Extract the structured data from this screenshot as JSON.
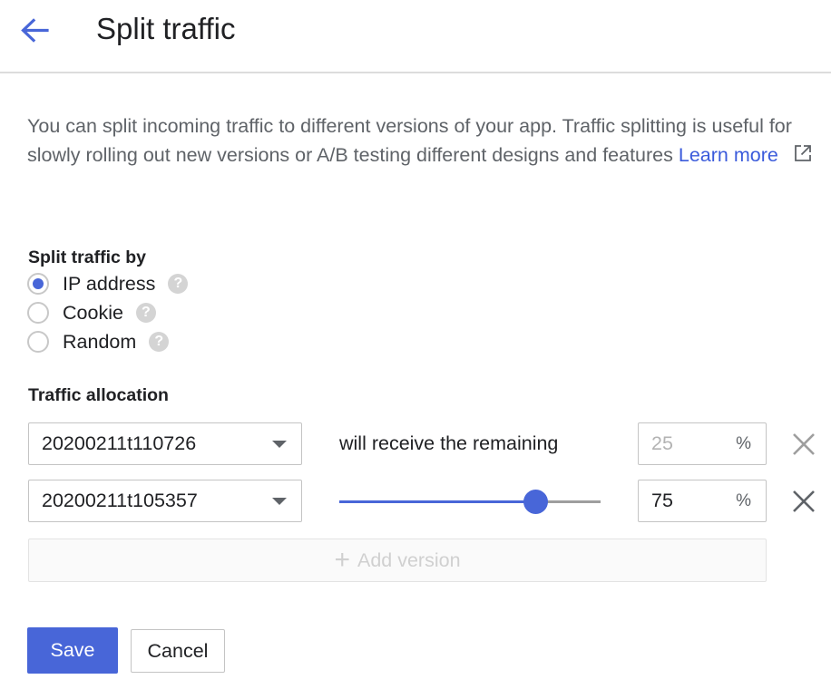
{
  "header": {
    "title": "Split traffic"
  },
  "description": {
    "text": "You can split incoming traffic to different versions of your app. Traffic splitting is useful for slowly rolling out new versions or A/B testing different designs and features",
    "link": "Learn more"
  },
  "split_by": {
    "label": "Split traffic by",
    "options": [
      {
        "label": "IP address",
        "checked": true
      },
      {
        "label": "Cookie",
        "checked": false
      },
      {
        "label": "Random",
        "checked": false
      }
    ],
    "help_glyph": "?"
  },
  "allocation": {
    "label": "Traffic allocation",
    "rows": [
      {
        "version": "20200211t110726",
        "note": "will receive the remaining",
        "percent": "25",
        "unit": "%"
      },
      {
        "version": "20200211t105357",
        "percent": "75",
        "unit": "%",
        "slider_value": 0.75
      }
    ],
    "add_version": "Add version"
  },
  "actions": {
    "save": "Save",
    "cancel": "Cancel"
  },
  "colors": {
    "accent": "#4866d8",
    "link": "#3b5bdb"
  },
  "icons": {
    "back": "arrow-left-icon",
    "external": "external-link-icon",
    "help": "help-icon",
    "remove": "close-icon",
    "dropdown": "caret-down-icon",
    "add": "plus-icon"
  }
}
